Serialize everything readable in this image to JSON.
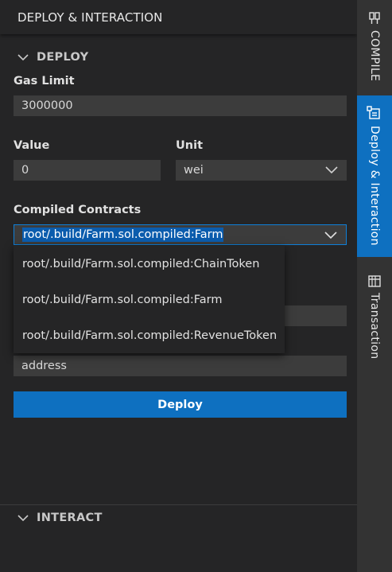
{
  "panel": {
    "title": "DEPLOY & INTERACTION"
  },
  "deploy": {
    "section_label": "DEPLOY",
    "gas_limit_label": "Gas Limit",
    "gas_limit_value": "3000000",
    "value_label": "Value",
    "value_value": "0",
    "unit_label": "Unit",
    "unit_selected": "wei",
    "compiled_contracts_label": "Compiled Contracts",
    "compiled_contracts_selected": "root/.build/Farm.sol.compiled:Farm",
    "contract_options": [
      "root/.build/Farm.sol.compiled:ChainToken",
      "root/.build/Farm.sol.compiled:Farm",
      "root/.build/Farm.sol.compiled:RevenueToken"
    ],
    "constructor_input_value": "address",
    "deploy_button_label": "Deploy"
  },
  "interact": {
    "section_label": "INTERACT"
  },
  "side_tabs": [
    {
      "label": "COMPILE",
      "icon": "compile-icon",
      "active": false
    },
    {
      "label": "Deploy & Interaction",
      "icon": "deploy-icon",
      "active": true
    },
    {
      "label": "Transaction",
      "icon": "transaction-icon",
      "active": false
    }
  ],
  "colors": {
    "accent": "#0e70c0",
    "focus_border": "#0e7fd8",
    "selection": "#0b5cad",
    "panel_bg": "#252526",
    "input_bg": "#3c3c3c",
    "tab_bar_bg": "#333333"
  }
}
